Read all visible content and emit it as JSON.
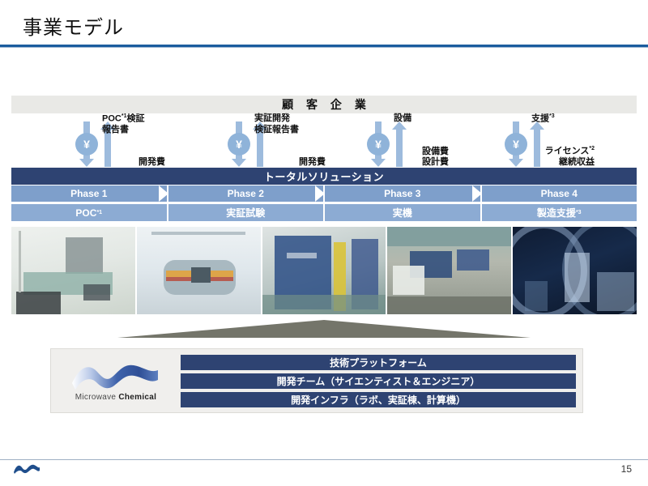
{
  "slide": {
    "title": "事業モデル",
    "page_number": "15",
    "accent_color": "#1a5c9e",
    "navy_color": "#2e4372",
    "phase_color": "#7e9fcb",
    "subphase_color": "#8cabd3",
    "arrow_color": "#9dbbdd",
    "banner_color": "#e9e9e6",
    "funnel_color": "#74756a"
  },
  "customer": {
    "banner_label": "顧 客 企 業"
  },
  "flows": [
    {
      "pay_label": "開発費",
      "deliver_label_line1": "POC",
      "deliver_sup": "*1",
      "deliver_label_line1_tail": "検証",
      "deliver_label_line2": "報告書",
      "currency_symbol": "¥"
    },
    {
      "pay_label": "開発費",
      "deliver_label_line1": "実証開発",
      "deliver_sup": "",
      "deliver_label_line1_tail": "",
      "deliver_label_line2": "検証報告書",
      "currency_symbol": "¥"
    },
    {
      "pay_label_line1": "設備費",
      "pay_label_line2": "設計費",
      "deliver_label_line1": "設備",
      "deliver_sup": "",
      "deliver_label_line1_tail": "",
      "deliver_label_line2": "",
      "currency_symbol": "¥"
    },
    {
      "pay_label_line1": "ライセンス",
      "pay_sup": "*2",
      "pay_label_line2": "継続収益",
      "deliver_label_line1": "支援",
      "deliver_sup": "*3",
      "deliver_label_line1_tail": "",
      "deliver_label_line2": "",
      "currency_symbol": "¥"
    }
  ],
  "solution": {
    "total_bar_label": "トータルソリューション",
    "phases": [
      {
        "phase_label": "Phase 1",
        "deliverable": "POC",
        "deliverable_sup": "*1"
      },
      {
        "phase_label": "Phase 2",
        "deliverable": "実証試験",
        "deliverable_sup": ""
      },
      {
        "phase_label": "Phase 3",
        "deliverable": "実機",
        "deliverable_sup": ""
      },
      {
        "phase_label": "Phase 4",
        "deliverable": "製造支援",
        "deliverable_sup": "*3"
      }
    ]
  },
  "photos": [
    {
      "caption": "lab-bench-equipment"
    },
    {
      "caption": "reactor-vessel"
    },
    {
      "caption": "pilot-plant-skid"
    },
    {
      "caption": "aerial-plant-site"
    },
    {
      "caption": "night-industrial-plant"
    }
  ],
  "platform": {
    "company_name_light": "Microwave",
    "company_name_bold": "Chemical",
    "bars": [
      "技術プラットフォーム",
      "開発チーム（サイエンティスト＆エンジニア）",
      "開発インフラ（ラボ、実証棟、計算機）"
    ]
  }
}
